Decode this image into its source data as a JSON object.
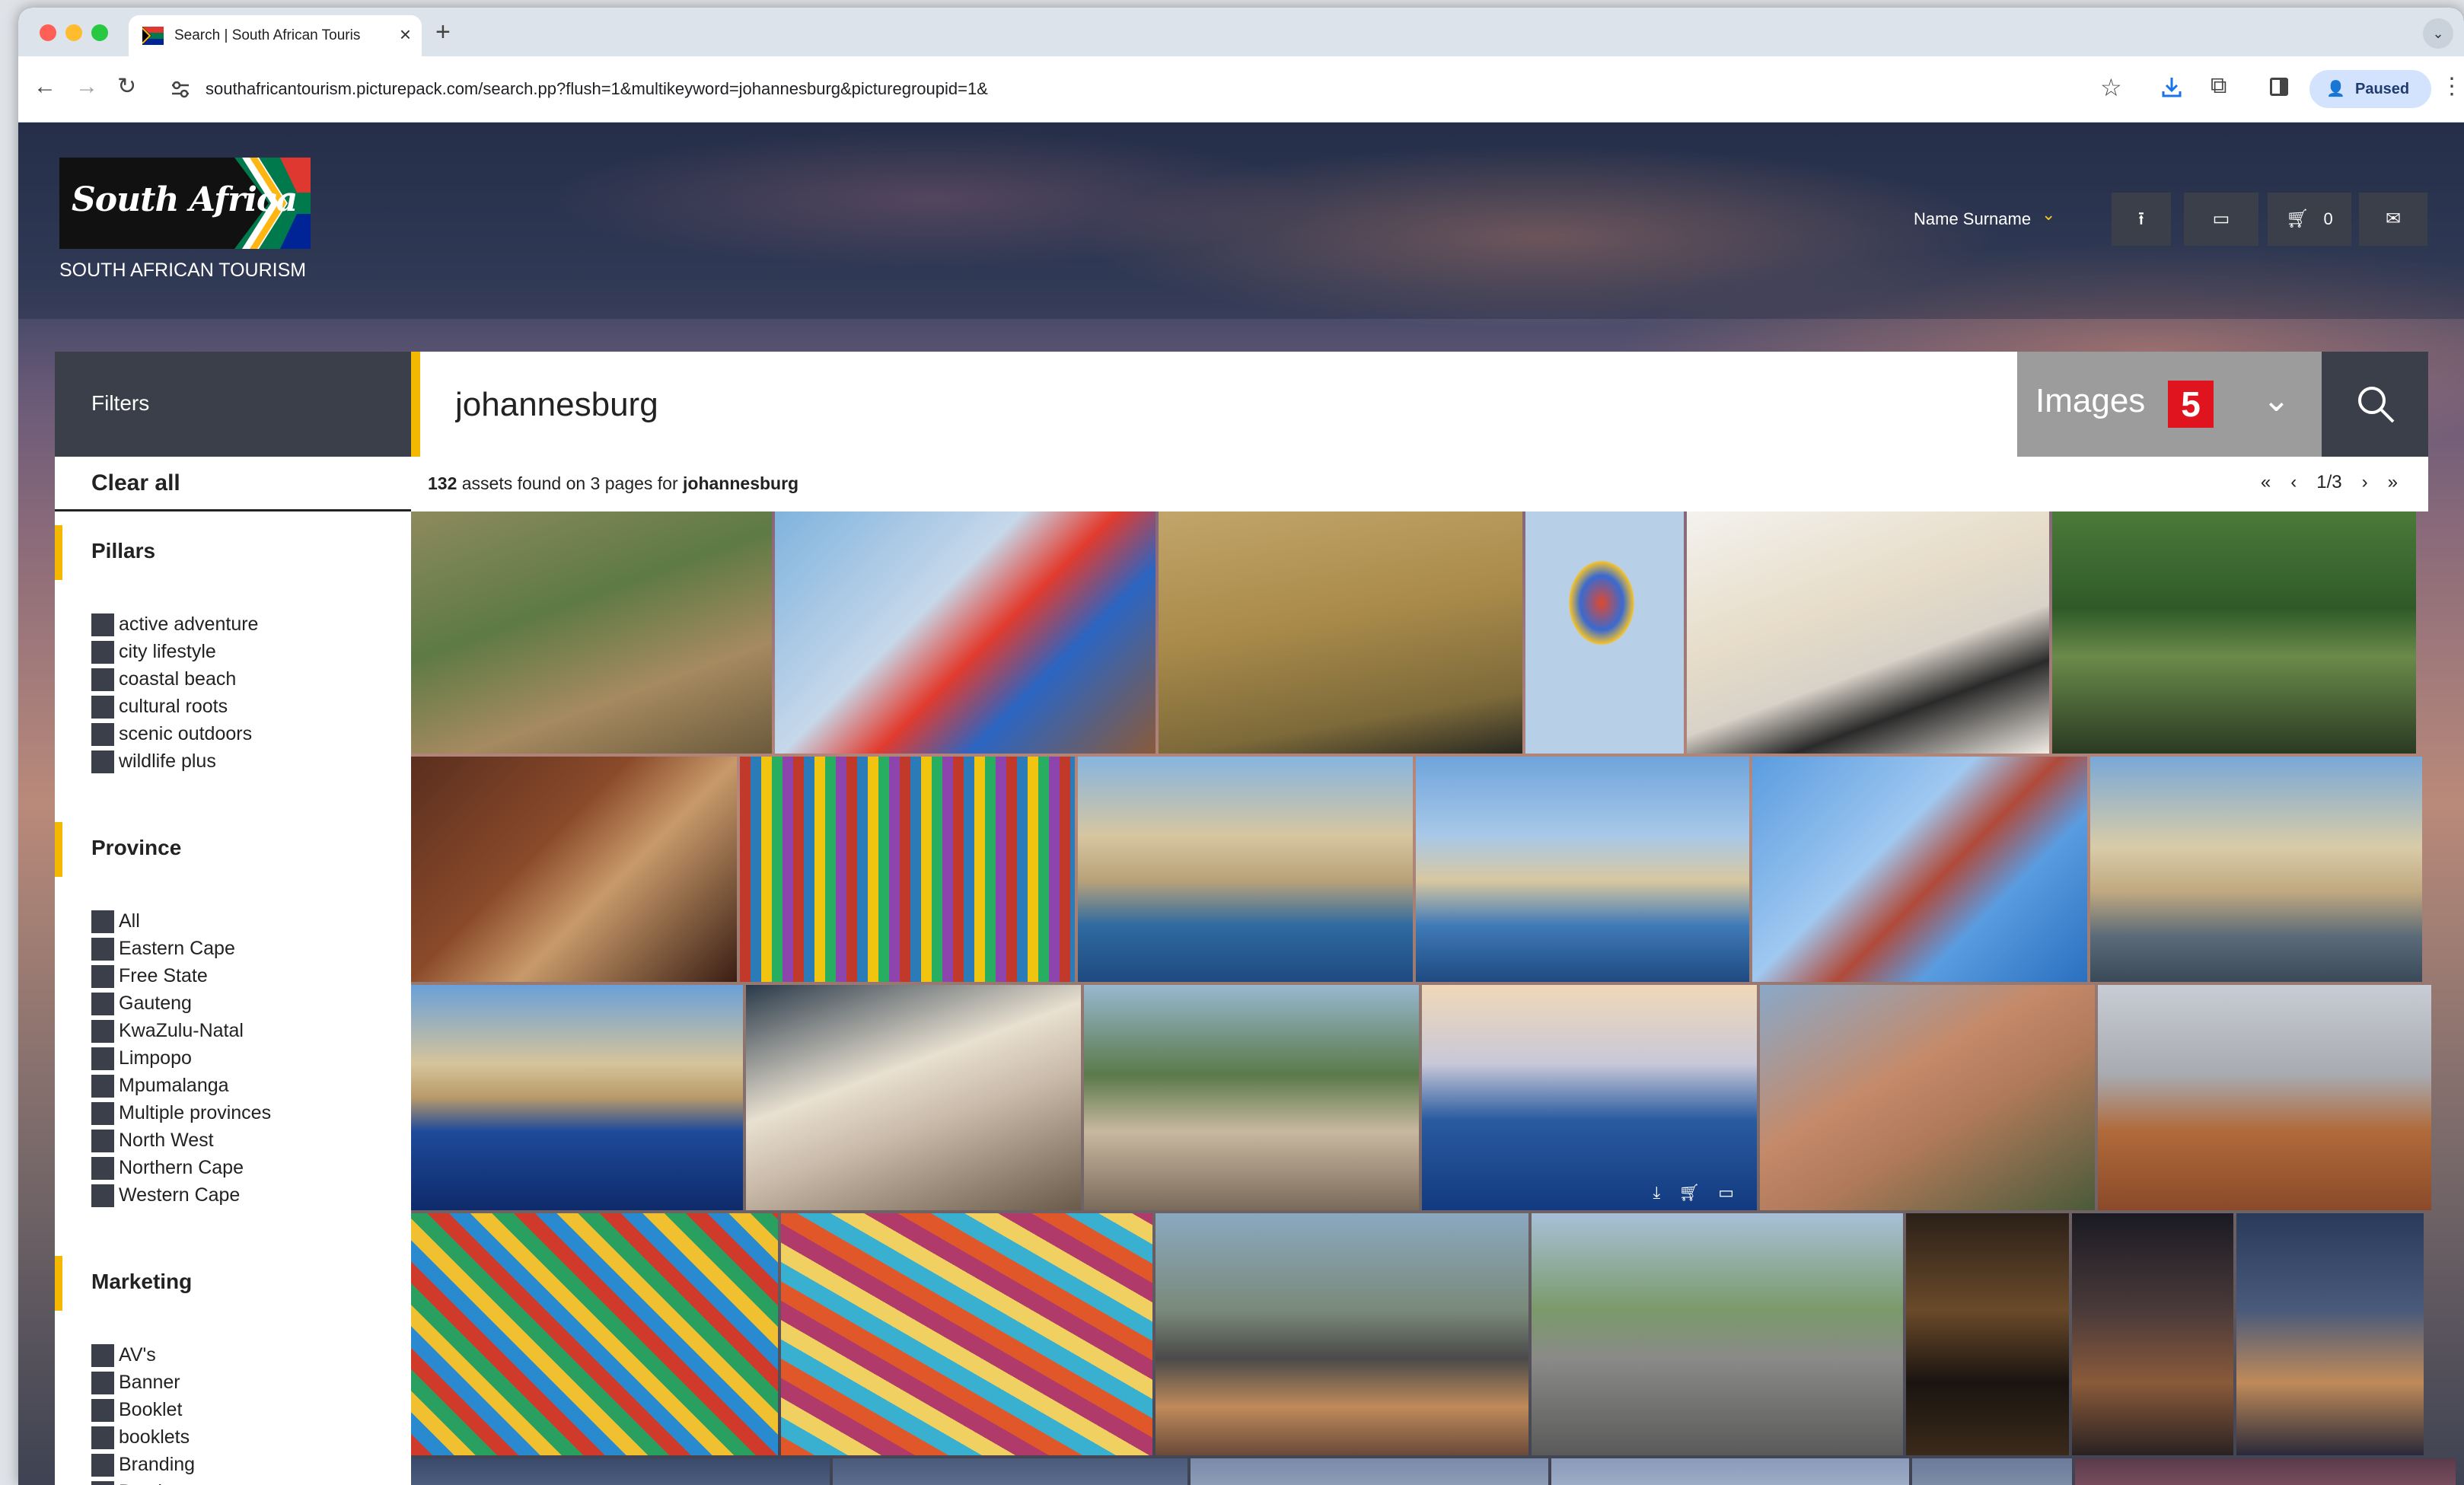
{
  "browser": {
    "tab_title": "Search | South African Touris",
    "tab_close": "×",
    "new_tab": "+",
    "tab_search": "⌄",
    "url": "southafricantourism.picturepack.com/search.pp?flush=1&multikeyword=johannesburg&picturegroupid=1&",
    "profile_label": "Paused",
    "icons": {
      "back": "arrow-left-icon",
      "forward": "arrow-right-icon",
      "reload": "reload-icon",
      "bookmark": "star-icon",
      "extensions": "puzzle-icon",
      "menu": "kebab-icon"
    },
    "glyphs": {
      "back": "←",
      "forward": "→",
      "reload": "↻",
      "bookmark": "☆",
      "extensions": "⧉",
      "menu": "⋮",
      "profile": "👤"
    }
  },
  "header": {
    "logo_wordmark": "South Africa",
    "logo_caption": "SOUTH AFRICAN TOURISM",
    "user_name": "Name Surname",
    "user_chevron": "⌄",
    "upload_glyph": "⭱",
    "lightbox_glyph": "▭",
    "cart_glyph": "🛒︎",
    "cart_count": "0",
    "mail_glyph": "✉"
  },
  "search": {
    "filters_label": "Filters",
    "query": "johannesburg",
    "type_label": "Images",
    "type_number": "5",
    "type_chevron": "⌄"
  },
  "sidebar": {
    "clear_all": "Clear all",
    "groups": [
      {
        "title": "Pillars",
        "options": [
          "active adventure",
          "city lifestyle",
          "coastal beach",
          "cultural roots",
          "scenic outdoors",
          "wildlife plus"
        ]
      },
      {
        "title": "Province",
        "options": [
          "All",
          "Eastern Cape",
          "Free State",
          "Gauteng",
          "KwaZulu-Natal",
          "Limpopo",
          "Mpumalanga",
          "Multiple provinces",
          "North West",
          "Northern Cape",
          "Western Cape"
        ]
      },
      {
        "title": "Marketing",
        "options": [
          "AV's",
          "Banner",
          "Booklet",
          "booklets",
          "Branding",
          "Brochure"
        ]
      }
    ]
  },
  "results": {
    "count": "132",
    "summary_middle": "assets found on 3 pages for",
    "query": "johannesburg",
    "pager": {
      "first": "«",
      "prev": "‹",
      "page": "1/3",
      "next": "›",
      "last": "»"
    },
    "tile_actions": [
      "⤓",
      "🛒︎",
      "▭"
    ]
  },
  "colors": {
    "accent_yellow": "#f5b800",
    "dark_panel": "#3a3f49",
    "badge_red": "#e0141e",
    "type_select_grey": "#9c9c9c"
  }
}
